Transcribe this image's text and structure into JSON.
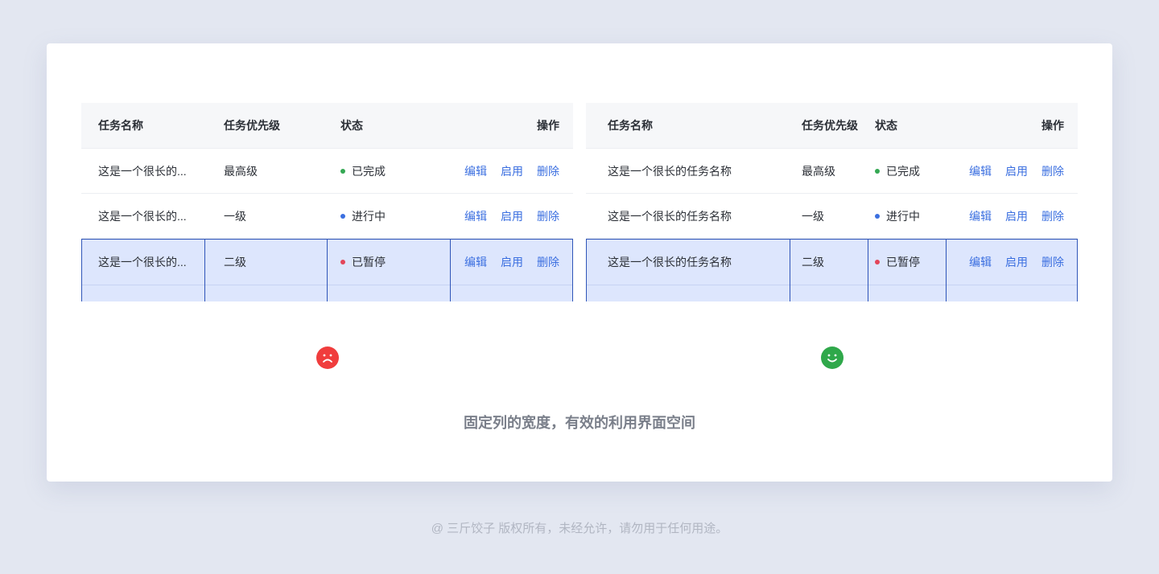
{
  "colors": {
    "done": "#34a853",
    "progress": "#3b6fe0",
    "paused": "#e3455a",
    "sad": "#f03d3d",
    "happy": "#2fa84a"
  },
  "left_table": {
    "headers": [
      "任务名称",
      "任务优先级",
      "状态",
      "操作"
    ],
    "rows": [
      {
        "name": "这是一个很长的...",
        "priority": "最高级",
        "status": "已完成",
        "status_color": "#34a853"
      },
      {
        "name": "这是一个很长的...",
        "priority": "一级",
        "status": "进行中",
        "status_color": "#3b6fe0"
      },
      {
        "name": "这是一个很长的...",
        "priority": "二级",
        "status": "已暂停",
        "status_color": "#e3455a"
      }
    ],
    "actions": [
      "编辑",
      "启用",
      "删除"
    ]
  },
  "right_table": {
    "headers": [
      "任务名称",
      "任务优先级",
      "状态",
      "操作"
    ],
    "rows": [
      {
        "name": "这是一个很长的任务名称",
        "priority": "最高级",
        "status": "已完成",
        "status_color": "#34a853"
      },
      {
        "name": "这是一个很长的任务名称",
        "priority": "一级",
        "status": "进行中",
        "status_color": "#3b6fe0"
      },
      {
        "name": "这是一个很长的任务名称",
        "priority": "二级",
        "status": "已暂停",
        "status_color": "#e3455a"
      }
    ],
    "actions": [
      "编辑",
      "启用",
      "删除"
    ]
  },
  "left_icon": "sad-face-icon",
  "right_icon": "happy-face-icon",
  "caption": "固定列的宽度，有效的利用界面空间",
  "footer": "@ 三斤饺子  版权所有，未经允许，请勿用于任何用途。"
}
